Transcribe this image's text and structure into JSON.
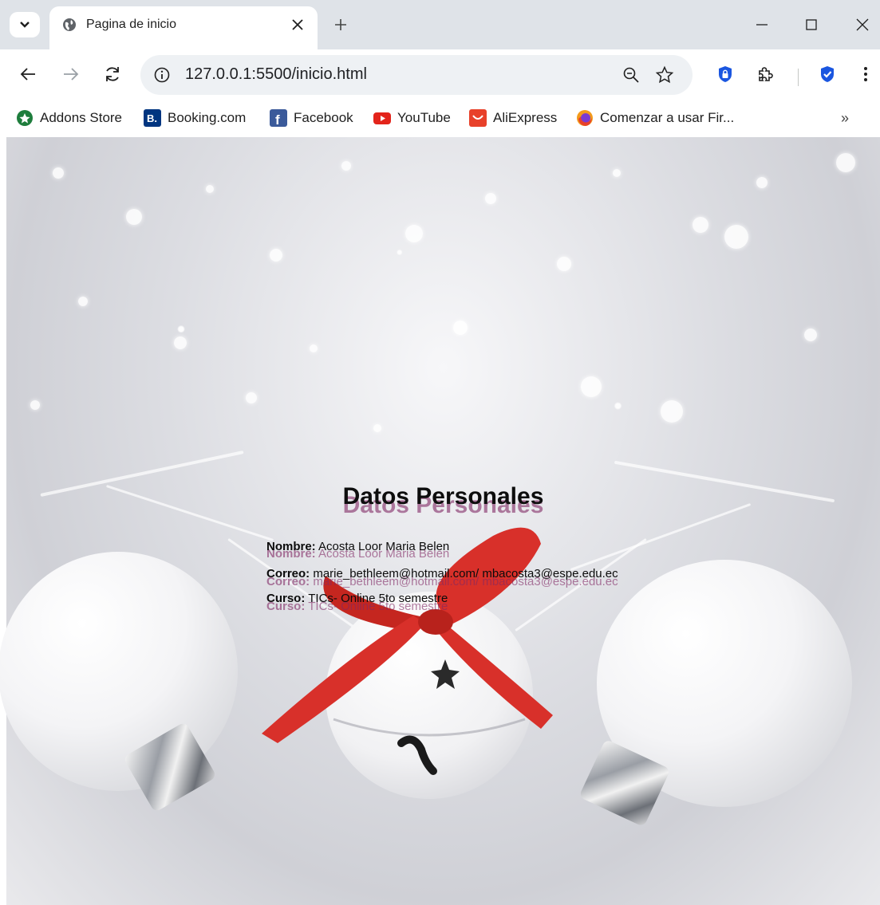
{
  "browser": {
    "tab_title": "Pagina de inicio",
    "url": "127.0.0.1:5500/inicio.html",
    "bookmarks": [
      {
        "label": "Addons Store",
        "icon": "addons-store-icon"
      },
      {
        "label": "Booking.com",
        "icon": "booking-icon"
      },
      {
        "label": "Facebook",
        "icon": "facebook-icon"
      },
      {
        "label": "YouTube",
        "icon": "youtube-icon"
      },
      {
        "label": "AliExpress",
        "icon": "aliexpress-icon"
      },
      {
        "label": "Comenzar a usar Fir...",
        "icon": "firefox-icon"
      }
    ],
    "more_bookmarks": "»"
  },
  "page": {
    "title": "Datos Personales",
    "fields": [
      {
        "label": "Nombre:",
        "value": "Acosta Loor Maria Belen"
      },
      {
        "label": "Correo:",
        "value": "marie_bethleem@hotmail.com/ mbacosta3@espe.edu.ec"
      },
      {
        "label": "Curso:",
        "value": "TICs- Online 5to semestre"
      }
    ]
  },
  "colors": {
    "text": "#0d0d0d",
    "text_shadow": "#802864",
    "ribbon": "#d8302a"
  }
}
